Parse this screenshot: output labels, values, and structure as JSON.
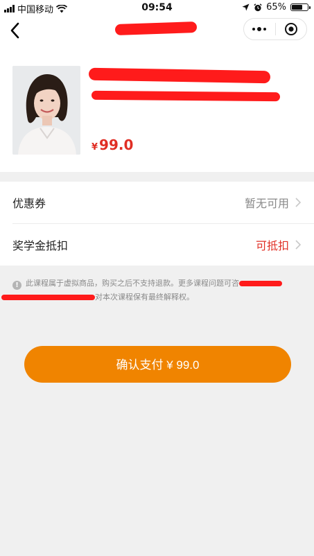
{
  "status_bar": {
    "carrier": "中国移动",
    "time": "09:54",
    "battery": "65%",
    "battery_level": 0.65
  },
  "navbar": {
    "title": ""
  },
  "product": {
    "title": "",
    "subtitle": "",
    "currency": "¥",
    "price": "99.0"
  },
  "rows": [
    {
      "label": "优惠券",
      "value": "暂无可用"
    },
    {
      "label": "奖学金抵扣",
      "value": "可抵扣"
    }
  ],
  "notice": {
    "part1": "此课程属于虚拟商品，购买之后不支持退款。更多课程问题可咨",
    "part2": "对本次课程保有最终解释权。"
  },
  "pay_button": {
    "label": "确认支付 ¥ 99.0"
  },
  "colors": {
    "accent_orange": "#f08400",
    "price_red": "#e02e24",
    "redaction": "#ff1b1b"
  }
}
